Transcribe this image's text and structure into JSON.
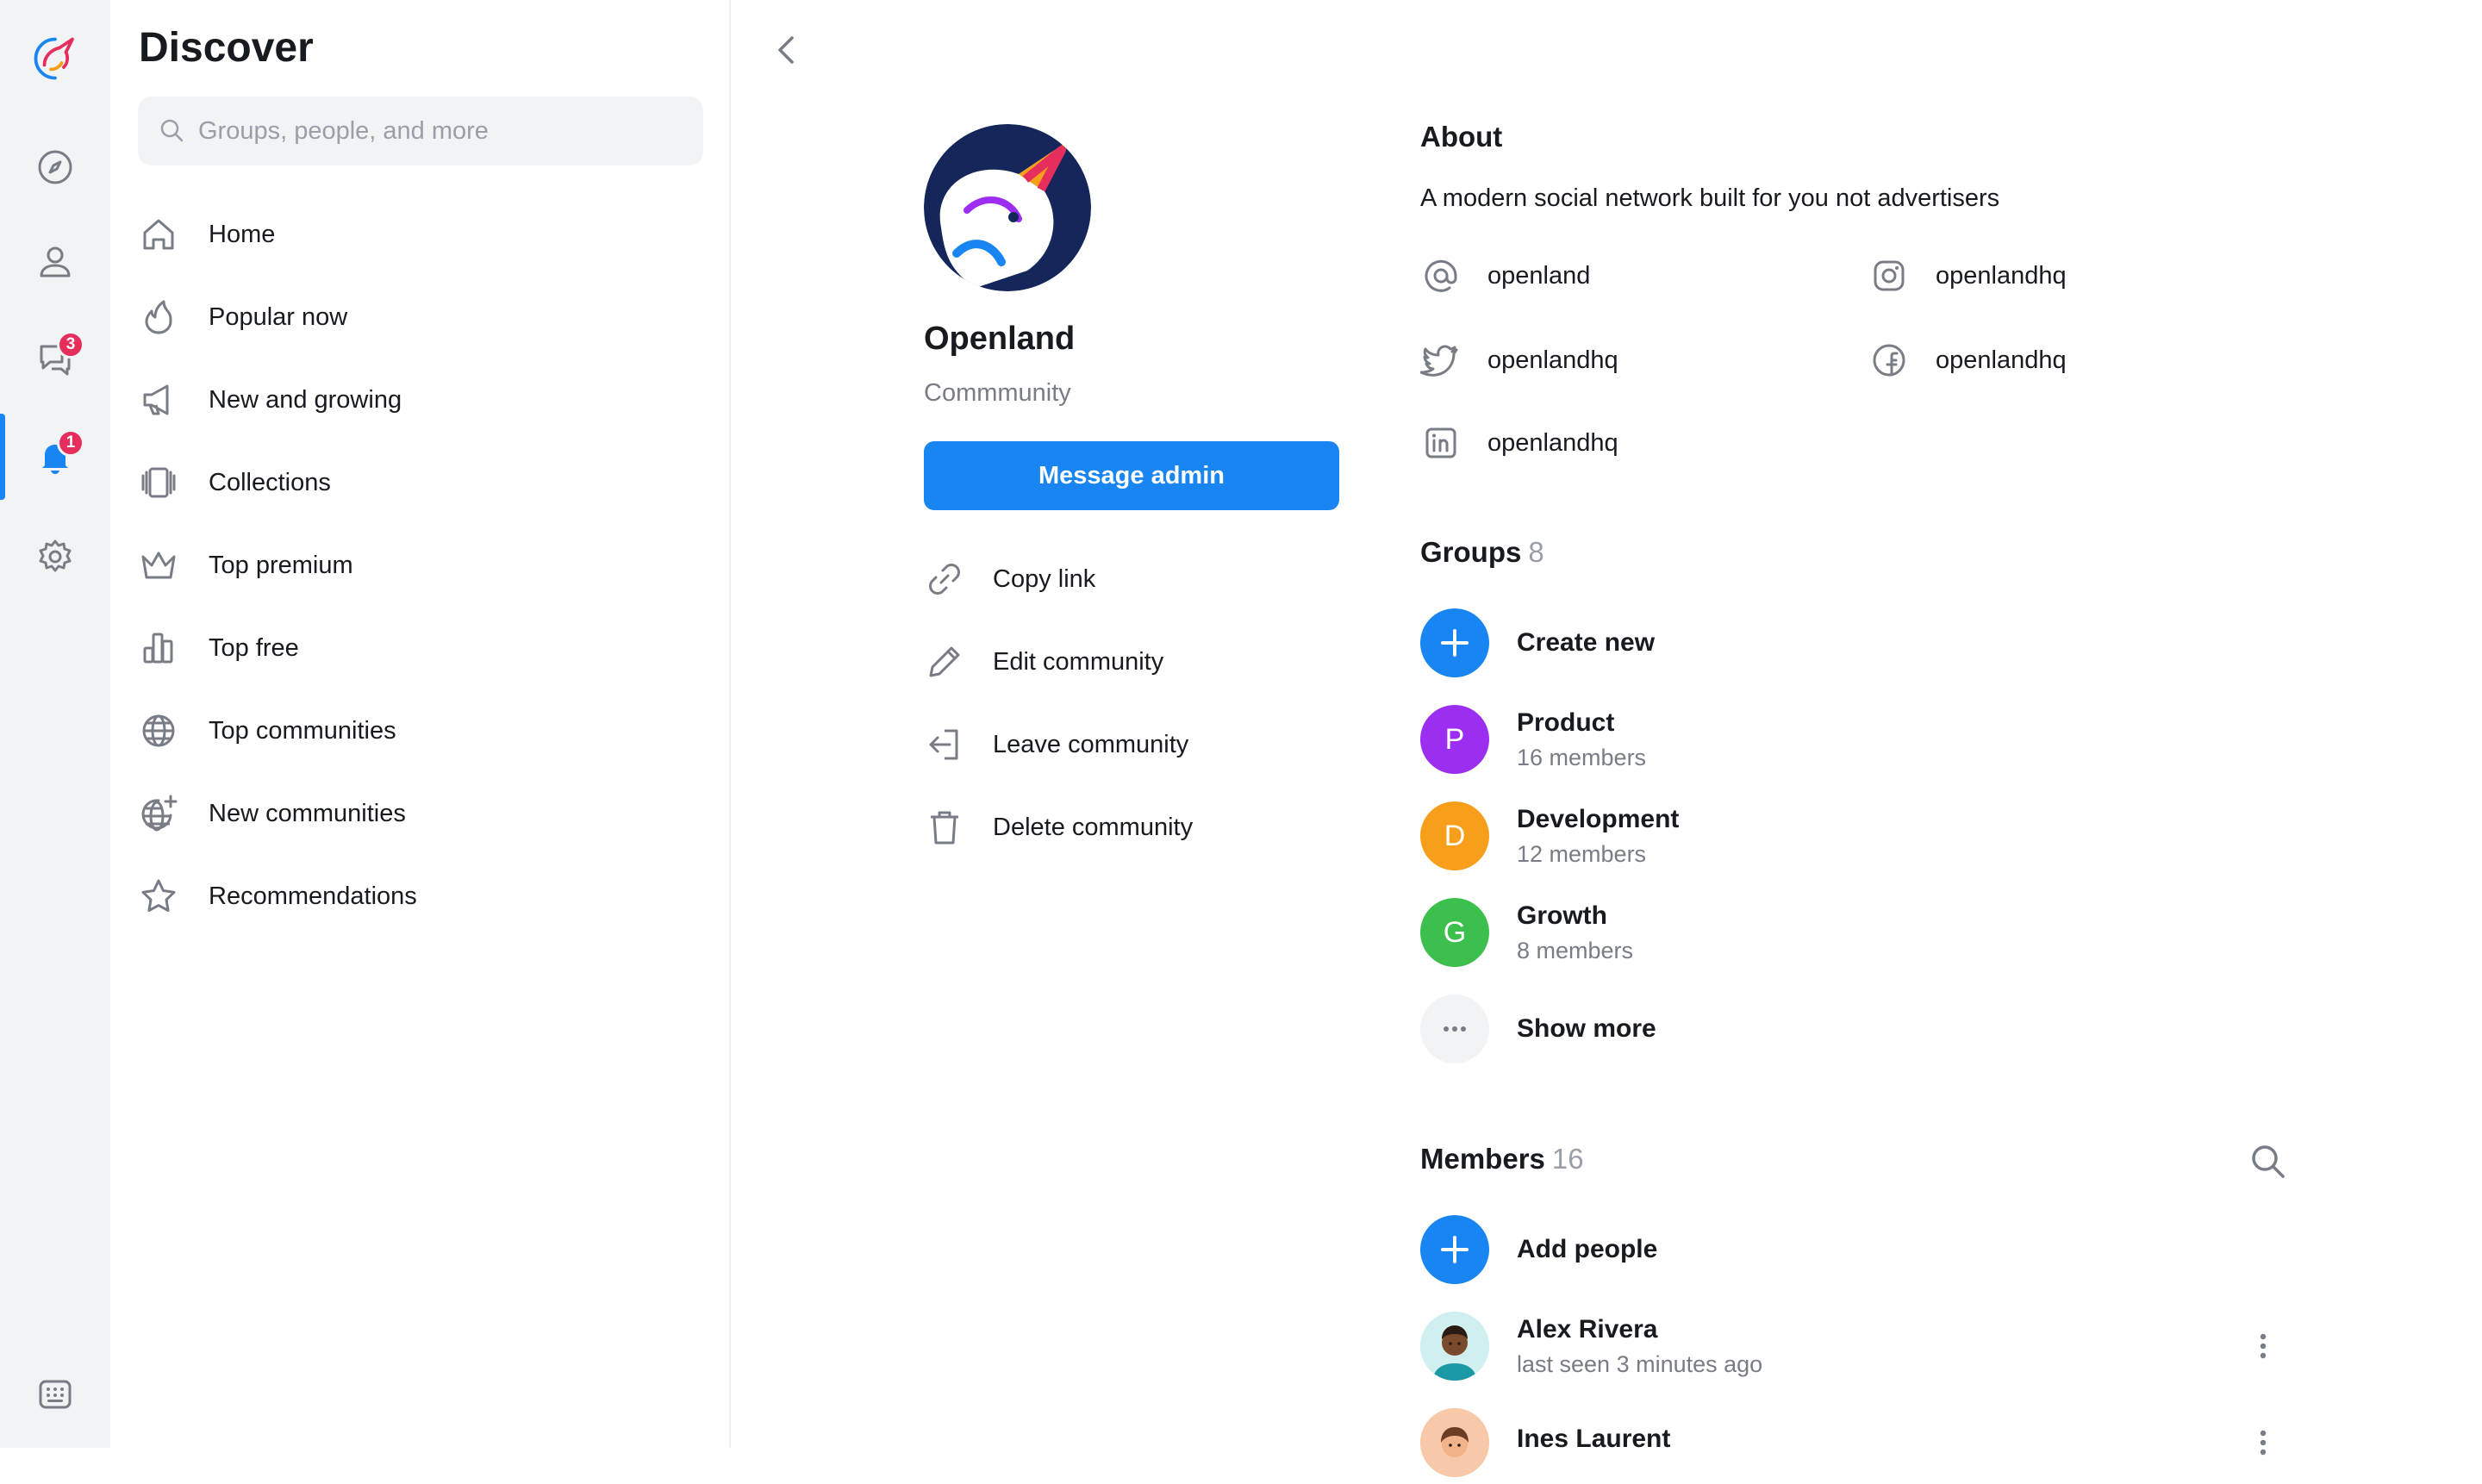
{
  "rail": {
    "badges": {
      "chats": "3",
      "notifications": "1"
    },
    "active_item": "notifications",
    "accent_color": "#1885f2",
    "badge_color": "#e62e5c"
  },
  "discover": {
    "title": "Discover",
    "search_placeholder": "Groups, people, and more",
    "nav": [
      {
        "label": "Home",
        "icon": "home-icon"
      },
      {
        "label": "Popular now",
        "icon": "flame-icon"
      },
      {
        "label": "New and growing",
        "icon": "megaphone-icon"
      },
      {
        "label": "Collections",
        "icon": "collections-icon"
      },
      {
        "label": "Top premium",
        "icon": "crown-icon"
      },
      {
        "label": "Top free",
        "icon": "bar-chart-icon"
      },
      {
        "label": "Top communities",
        "icon": "globe-icon"
      },
      {
        "label": "New communities",
        "icon": "globe-sparkle-icon"
      },
      {
        "label": "Recommendations",
        "icon": "star-icon"
      }
    ]
  },
  "community": {
    "name": "Openland",
    "type": "Commmunity",
    "message_admin": "Message admin",
    "actions": [
      {
        "label": "Copy link",
        "icon": "link-icon"
      },
      {
        "label": "Edit community",
        "icon": "pencil-icon"
      },
      {
        "label": "Leave community",
        "icon": "leave-icon"
      },
      {
        "label": "Delete community",
        "icon": "trash-icon"
      }
    ]
  },
  "about": {
    "title": "About",
    "description": "A modern social network built for you not advertisers",
    "socials": [
      {
        "handle": "openland",
        "icon": "at-icon"
      },
      {
        "handle": "openlandhq",
        "icon": "instagram-icon"
      },
      {
        "handle": "openlandhq",
        "icon": "twitter-icon"
      },
      {
        "handle": "openlandhq",
        "icon": "facebook-icon"
      },
      {
        "handle": "openlandhq",
        "icon": "linkedin-icon"
      }
    ]
  },
  "groups": {
    "title": "Groups",
    "count": "8",
    "create_label": "Create new",
    "items": [
      {
        "initial": "P",
        "name": "Product",
        "members": "16 members",
        "color": "#9b2ef0"
      },
      {
        "initial": "D",
        "name": "Development",
        "members": "12 members",
        "color": "#f79e1b"
      },
      {
        "initial": "G",
        "name": "Growth",
        "members": "8 members",
        "color": "#3dbf4d"
      }
    ],
    "show_more": "Show more"
  },
  "members": {
    "title": "Members",
    "count": "16",
    "add_label": "Add people",
    "items": [
      {
        "name": "Alex Rivera",
        "status": "last seen 3 minutes ago"
      },
      {
        "name": "Ines Laurent",
        "status": ""
      }
    ]
  }
}
